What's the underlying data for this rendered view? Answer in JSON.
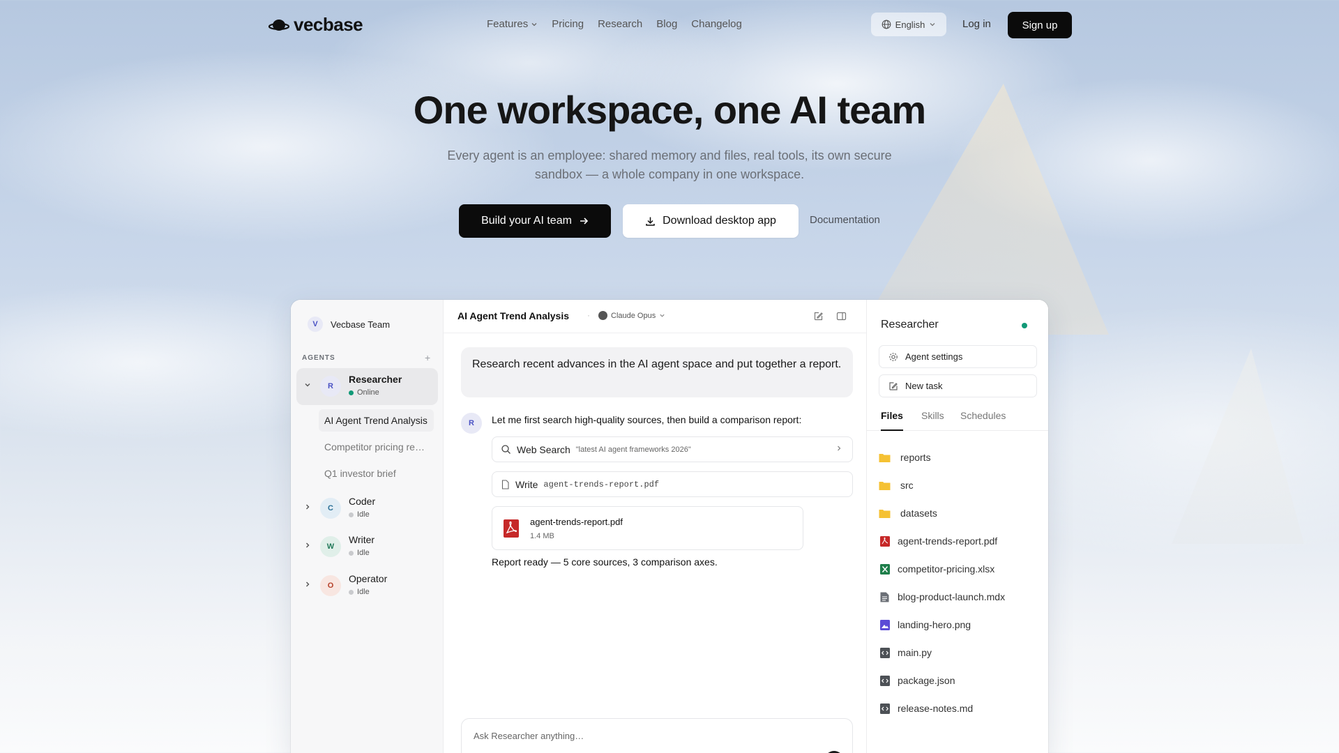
{
  "nav": {
    "brand": "vecbase",
    "links": [
      {
        "label": "Features",
        "has_dropdown": true
      },
      {
        "label": "Pricing"
      },
      {
        "label": "Research"
      },
      {
        "label": "Blog"
      },
      {
        "label": "Changelog"
      }
    ],
    "language": "English",
    "login": "Log in",
    "signup": "Sign up"
  },
  "hero": {
    "title": "One workspace, one AI team",
    "subtitle": "Every agent is an employee: shared memory and files, real tools, its own secure sandbox — a whole company in one workspace.",
    "primary_cta": "Build your AI team",
    "secondary_cta": "Download desktop app",
    "docs_link": "Documentation"
  },
  "app": {
    "team_initial": "V",
    "team_name": "Vecbase Team",
    "agents_label": "AGENTS",
    "agents": [
      {
        "initial": "R",
        "name": "Researcher",
        "status": "Online",
        "status_color": "#119977",
        "avatar_bg": "#e8e9f6",
        "avatar_fg": "#4a52c4",
        "expanded": true
      },
      {
        "initial": "C",
        "name": "Coder",
        "status": "Idle",
        "status_color": "#c9cacd",
        "avatar_bg": "#e2edf5",
        "avatar_fg": "#2a6f96",
        "expanded": false
      },
      {
        "initial": "W",
        "name": "Writer",
        "status": "Idle",
        "status_color": "#c9cacd",
        "avatar_bg": "#e0efe9",
        "avatar_fg": "#237a5a",
        "expanded": false
      },
      {
        "initial": "O",
        "name": "Operator",
        "status": "Idle",
        "status_color": "#c9cacd",
        "avatar_bg": "#f8e6e1",
        "avatar_fg": "#b6412a",
        "expanded": false
      }
    ],
    "tasks": [
      "AI Agent Trend Analysis",
      "Competitor pricing re…",
      "Q1 investor brief"
    ],
    "chat": {
      "title": "AI Agent Trend Analysis",
      "model": "Claude Opus",
      "prompt": "Research recent advances in the AI agent space and put together a report.",
      "reply_initial": "R",
      "reply": "Let me first search high-quality sources, then build a comparison report:",
      "tool_search_label": "Web Search",
      "tool_search_arg": "\"latest AI agent frameworks 2026\"",
      "tool_write_label": "Write",
      "tool_write_arg": "agent-trends-report.pdf",
      "file_name": "agent-trends-report.pdf",
      "file_size": "1.4 MB",
      "final": "Report ready — 5 core sources, 3 comparison axes.",
      "composer_placeholder": "Ask Researcher anything…"
    },
    "panel": {
      "title": "Researcher",
      "agent_settings": "Agent settings",
      "new_task": "New task",
      "tabs": [
        "Files",
        "Skills",
        "Schedules"
      ],
      "files": [
        {
          "name": "reports",
          "icon": "folder-icon"
        },
        {
          "name": "src",
          "icon": "folder-icon"
        },
        {
          "name": "datasets",
          "icon": "folder-icon"
        },
        {
          "name": "agent-trends-report.pdf",
          "icon": "pdf-file-icon"
        },
        {
          "name": "competitor-pricing.xlsx",
          "icon": "spreadsheet-file-icon"
        },
        {
          "name": "blog-product-launch.mdx",
          "icon": "document-file-icon"
        },
        {
          "name": "landing-hero.png",
          "icon": "image-file-icon"
        },
        {
          "name": "main.py",
          "icon": "code-file-icon"
        },
        {
          "name": "package.json",
          "icon": "code-file-icon"
        },
        {
          "name": "release-notes.md",
          "icon": "code-file-icon"
        }
      ]
    }
  }
}
